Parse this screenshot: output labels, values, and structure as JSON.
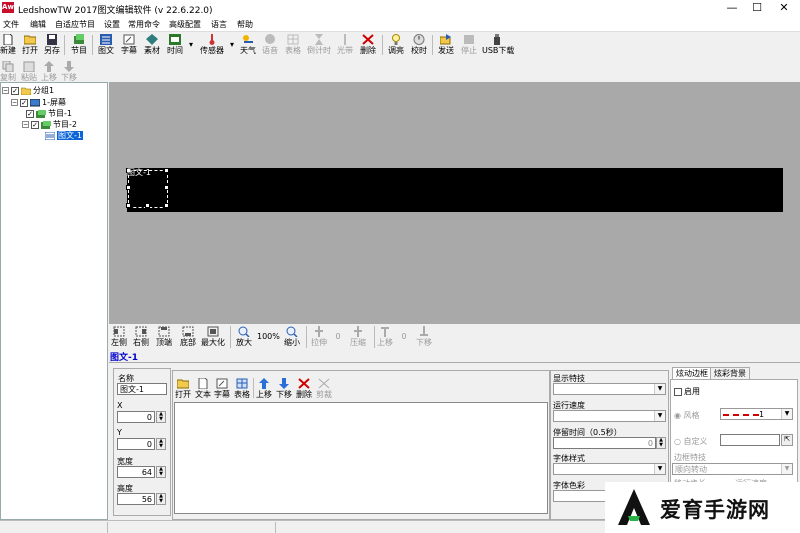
{
  "window": {
    "title": "LedshowTW 2017图文编辑软件 (v 22.6.22.0)",
    "app_icon": "Aw"
  },
  "menu": [
    "文件",
    "编辑",
    "自适应节目",
    "设置",
    "常用命令",
    "高级配置",
    "语言",
    "帮助"
  ],
  "toolbar1": [
    "新建",
    "打开",
    "另存",
    "节目",
    "图文",
    "字幕",
    "素材",
    "时间",
    "传感器",
    "天气",
    "语音",
    "表格",
    "倒计时",
    "光带",
    "删除",
    "调亮",
    "校时",
    "发送",
    "停止",
    "USB下载"
  ],
  "toolbar2": [
    "复制",
    "粘贴",
    "上移",
    "下移"
  ],
  "tree": {
    "group": "分组1",
    "screen": "1-屏幕",
    "program1": "节目-1",
    "program2": "节目-2",
    "item": "图文-1"
  },
  "canvas": {
    "object_label": "图文-1"
  },
  "edit_toolbar": {
    "left": "左侧",
    "right": "右侧",
    "top": "顶端",
    "bottom": "底部",
    "maximize": "最大化",
    "zoom_in": "放大",
    "zoom_level": "100%",
    "zoom_out": "缩小",
    "stretch": "拉伸",
    "stretch_val": "0",
    "compress": "压缩",
    "move_up": "上移",
    "move_val": "0",
    "move_down": "下移"
  },
  "section_title": "图文-1",
  "props": {
    "name_label": "名称",
    "name_value": "图文-1",
    "x_label": "X",
    "x_value": "0",
    "y_label": "Y",
    "y_value": "0",
    "width_label": "宽度",
    "width_value": "64",
    "height_label": "高度",
    "height_value": "56"
  },
  "text_toolbar": [
    "打开",
    "文本",
    "字幕",
    "表格",
    "上移",
    "下移",
    "删除",
    "剪裁"
  ],
  "display": {
    "effect_label": "显示特技",
    "speed_label": "运行速度",
    "stay_label": "停留时间（0.5秒）",
    "stay_value": "0",
    "font_style_label": "字体样式",
    "font_color_label": "字体色彩"
  },
  "border": {
    "tab1": "炫动边框",
    "tab2": "炫彩背景",
    "enable": "启用",
    "style": "风格",
    "style_value": "1",
    "custom": "自定义",
    "effect_label": "边框特技",
    "effect_value": "顺向转动",
    "speed_label": "移动步长",
    "run_label": "运行速度"
  },
  "watermark": {
    "text": "爱育手游网"
  },
  "colors": {
    "accent": "#0000cc",
    "canvas_bg": "#a9a9a9",
    "led": "#000000",
    "delete": "#d00000"
  }
}
